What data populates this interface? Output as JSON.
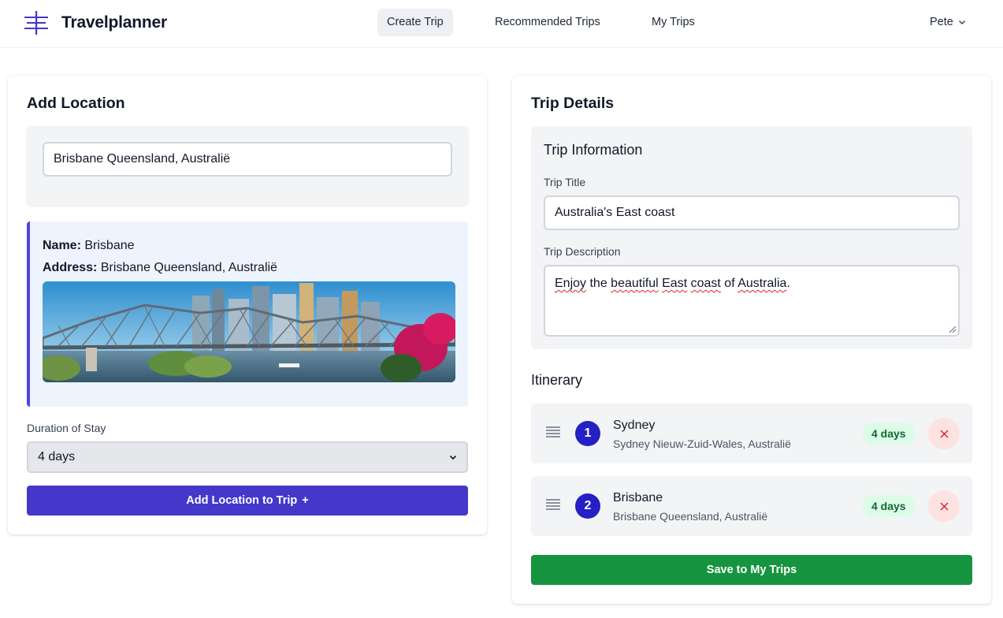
{
  "app": {
    "name": "Travelplanner",
    "user": "Pete"
  },
  "nav": {
    "items": [
      {
        "label": "Create Trip",
        "active": true
      },
      {
        "label": "Recommended Trips",
        "active": false
      },
      {
        "label": "My Trips",
        "active": false
      }
    ]
  },
  "add_location": {
    "title": "Add Location",
    "search_value": "Brisbane Queensland, Australië",
    "name_label": "Name:",
    "name_value": "Brisbane",
    "address_label": "Address:",
    "address_value": "Brisbane Queensland, Australië",
    "duration_label": "Duration of Stay",
    "duration_value": "4 days",
    "add_button": "Add Location to Trip",
    "add_button_icon": "+"
  },
  "trip_details": {
    "title": "Trip Details",
    "info_title": "Trip Information",
    "title_label": "Trip Title",
    "title_value": "Australia's East coast",
    "description_label": "Trip Description",
    "description_words": [
      "Enjoy",
      " the ",
      "beautiful",
      " ",
      "East",
      " ",
      "coast",
      " of ",
      "Australia",
      "."
    ],
    "itinerary_title": "Itinerary",
    "itinerary": [
      {
        "number": "1",
        "name": "Sydney",
        "address": "Sydney Nieuw-Zuid-Wales, Australië",
        "duration": "4 days"
      },
      {
        "number": "2",
        "name": "Brisbane",
        "address": "Brisbane Queensland, Australië",
        "duration": "4 days"
      }
    ],
    "save_button": "Save to My Trips"
  },
  "colors": {
    "primary": "#4338ca",
    "badge_bg": "#dcfce7",
    "badge_text": "#166534",
    "save": "#16943f",
    "remove_bg": "#fde2e2",
    "remove_icon": "#dc2626"
  }
}
